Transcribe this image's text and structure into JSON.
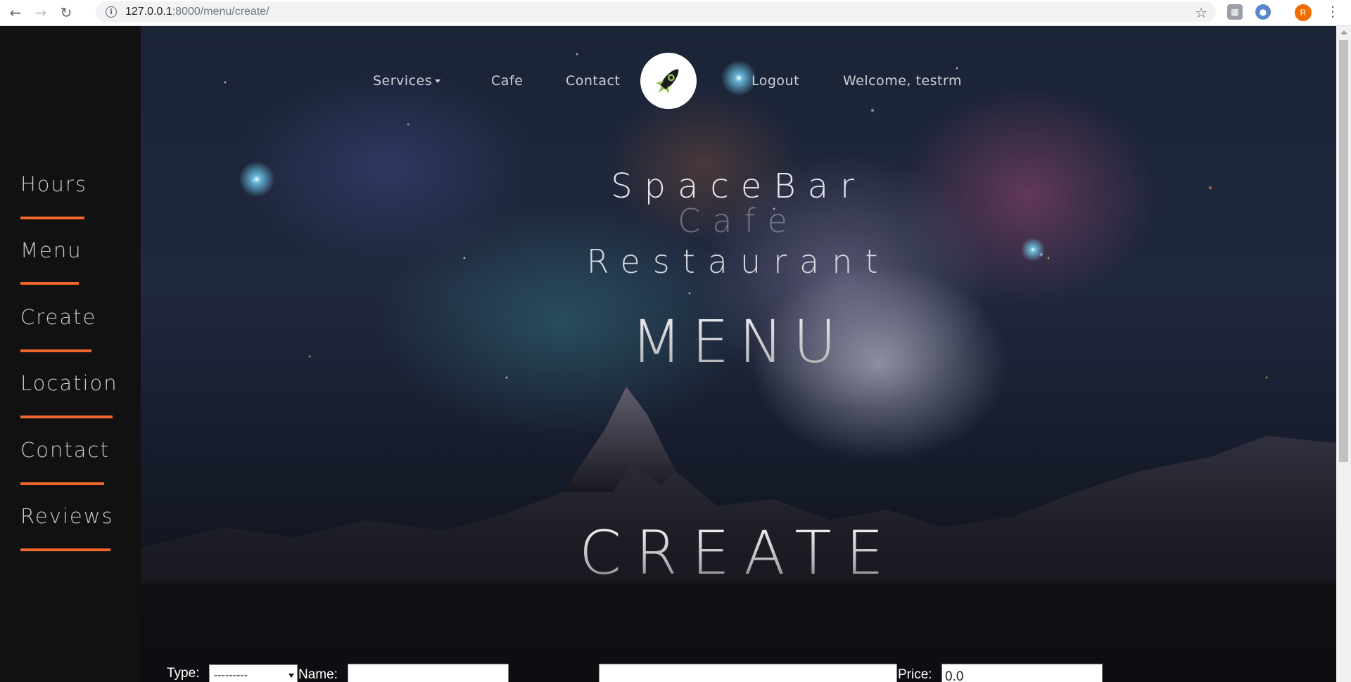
{
  "browser": {
    "url_host": "127.0.0.1",
    "url_path": ":8000/menu/create/",
    "avatar_letter": "R"
  },
  "sidebar": {
    "items": [
      {
        "label": "Hours"
      },
      {
        "label": "Menu"
      },
      {
        "label": "Create"
      },
      {
        "label": "Location"
      },
      {
        "label": "Contact"
      },
      {
        "label": "Reviews"
      }
    ],
    "accent_color": "#f0672b"
  },
  "topnav": {
    "services": "Services",
    "cafe": "Cafe",
    "contact": "Contact",
    "logout": "Logout",
    "welcome": "Welcome, testrm"
  },
  "hero": {
    "line1": "SpaceBar",
    "line2": "Cafe",
    "line3": "Restaurant",
    "section": "MENU",
    "page": "CREATE"
  },
  "form": {
    "type_label": "Type:",
    "type_value": "---------",
    "name_label": "Name:",
    "name_value": "",
    "price_label": "Price:",
    "price_value": "0.0"
  }
}
